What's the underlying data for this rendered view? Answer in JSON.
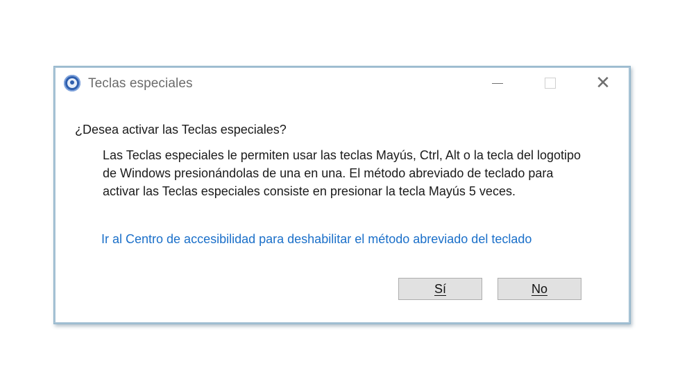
{
  "window": {
    "title": "Teclas especiales",
    "controls": {
      "minimize": "minimize-icon",
      "maximize": "maximize-icon",
      "close": "close-icon"
    },
    "icon": "accessibility-icon"
  },
  "content": {
    "question": "¿Desea activar las Teclas especiales?",
    "description": "Las Teclas especiales le permiten usar las teclas Mayús, Ctrl, Alt o la tecla del logotipo de Windows presionándolas de una en una. El método abreviado de teclado para activar las Teclas especiales consiste en presionar la tecla Mayús 5 veces.",
    "link": "Ir al Centro de accesibilidad para deshabilitar el método abreviado del teclado"
  },
  "buttons": {
    "yes": "Sí",
    "no": "No"
  },
  "colors": {
    "link": "#1a6fc9",
    "border": "#a9c4d6",
    "button_bg": "#e1e1e1"
  }
}
